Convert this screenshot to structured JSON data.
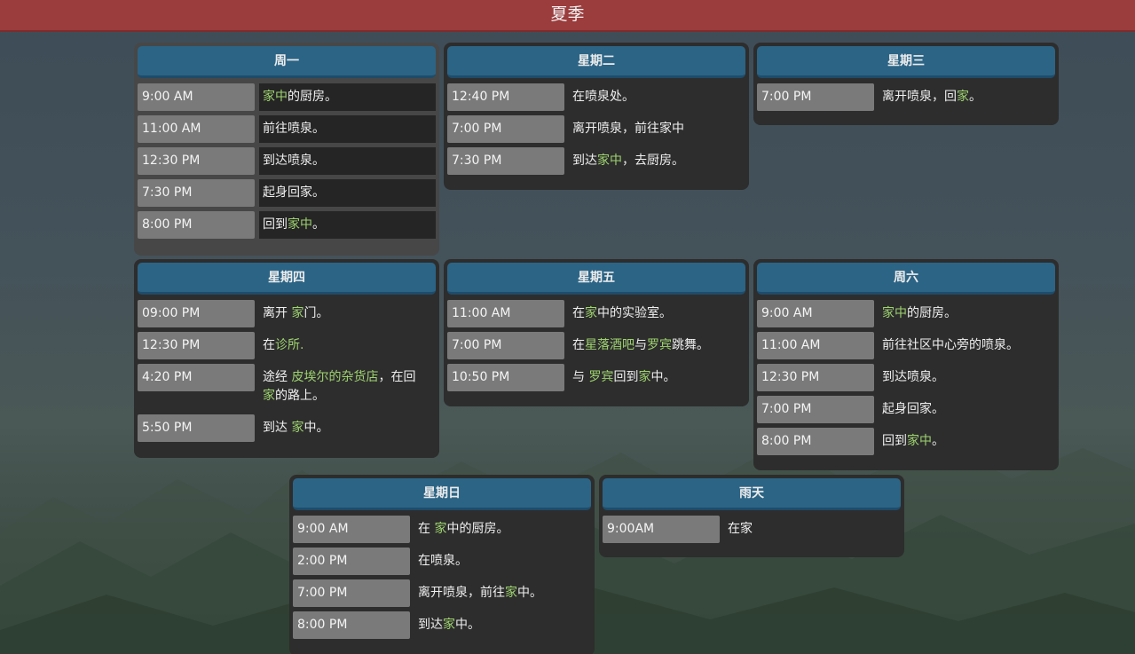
{
  "page": {
    "title": "夏季"
  },
  "colors": {
    "topbar": "#9b3c3d",
    "header": "#2c6485",
    "card": "#2d2d2d",
    "time_cell": "#7a7a7a",
    "highlight": "#9ed36f"
  },
  "cards": [
    {
      "title": "周一",
      "rows": [
        {
          "time": "9:00 AM",
          "desc": [
            {
              "t": "家中",
              "hl": true
            },
            {
              "t": "的厨房。"
            }
          ]
        },
        {
          "time": "11:00 AM",
          "desc": [
            {
              "t": "前往喷泉。"
            }
          ]
        },
        {
          "time": "12:30 PM",
          "desc": [
            {
              "t": "到达喷泉。"
            }
          ]
        },
        {
          "time": "7:30 PM",
          "desc": [
            {
              "t": "起身回家。"
            }
          ]
        },
        {
          "time": "8:00 PM",
          "desc": [
            {
              "t": "回到"
            },
            {
              "t": "家中",
              "hl": true
            },
            {
              "t": "。"
            }
          ]
        }
      ]
    },
    {
      "title": "星期二",
      "rows": [
        {
          "time": "12:40 PM",
          "desc": [
            {
              "t": "在喷泉处。"
            }
          ]
        },
        {
          "time": "7:00 PM",
          "desc": [
            {
              "t": "离开喷泉，前往家中"
            }
          ]
        },
        {
          "time": "7:30 PM",
          "desc": [
            {
              "t": "到达"
            },
            {
              "t": "家中",
              "hl": true
            },
            {
              "t": "，去厨房。"
            }
          ]
        }
      ]
    },
    {
      "title": "星期三",
      "rows": [
        {
          "time": "7:00 PM",
          "desc": [
            {
              "t": "离开喷泉，回"
            },
            {
              "t": "家",
              "hl": true
            },
            {
              "t": "。"
            }
          ]
        }
      ]
    },
    {
      "title": "星期四",
      "rows": [
        {
          "time": "09:00 PM",
          "desc": [
            {
              "t": "离开 "
            },
            {
              "t": "家",
              "hl": true
            },
            {
              "t": "门。"
            }
          ]
        },
        {
          "time": "12:30 PM",
          "desc": [
            {
              "t": "在"
            },
            {
              "t": "诊所.",
              "hl": true
            }
          ]
        },
        {
          "time": "4:20 PM",
          "desc": [
            {
              "t": "途经 "
            },
            {
              "t": "皮埃尔的杂货店",
              "hl": true
            },
            {
              "t": "，在回 "
            },
            {
              "t": "家",
              "hl": true
            },
            {
              "t": "的路上。"
            }
          ]
        },
        {
          "time": "5:50 PM",
          "desc": [
            {
              "t": "到达 "
            },
            {
              "t": "家",
              "hl": true
            },
            {
              "t": "中。"
            }
          ]
        }
      ]
    },
    {
      "title": "星期五",
      "rows": [
        {
          "time": "11:00 AM",
          "desc": [
            {
              "t": "在"
            },
            {
              "t": "家",
              "hl": true
            },
            {
              "t": "中的实验室。"
            }
          ]
        },
        {
          "time": "7:00 PM",
          "desc": [
            {
              "t": "在"
            },
            {
              "t": "星落酒吧",
              "hl": true
            },
            {
              "t": "与"
            },
            {
              "t": "罗宾",
              "hl": true
            },
            {
              "t": "跳舞。"
            }
          ]
        },
        {
          "time": "10:50 PM",
          "desc": [
            {
              "t": "与 "
            },
            {
              "t": "罗宾",
              "hl": true
            },
            {
              "t": "回到"
            },
            {
              "t": "家",
              "hl": true
            },
            {
              "t": "中。"
            }
          ]
        }
      ]
    },
    {
      "title": "周六",
      "rows": [
        {
          "time": "9:00 AM",
          "desc": [
            {
              "t": "家中",
              "hl": true
            },
            {
              "t": "的厨房。"
            }
          ]
        },
        {
          "time": "11:00 AM",
          "desc": [
            {
              "t": "前往社区中心旁的喷泉。"
            }
          ]
        },
        {
          "time": "12:30 PM",
          "desc": [
            {
              "t": "到达喷泉。"
            }
          ]
        },
        {
          "time": "7:00 PM",
          "desc": [
            {
              "t": "起身回家。"
            }
          ]
        },
        {
          "time": "8:00 PM",
          "desc": [
            {
              "t": "回到"
            },
            {
              "t": "家中",
              "hl": true
            },
            {
              "t": "。"
            }
          ]
        }
      ]
    },
    {
      "title": "星期日",
      "rows": [
        {
          "time": "9:00 AM",
          "desc": [
            {
              "t": "在 "
            },
            {
              "t": "家",
              "hl": true
            },
            {
              "t": "中的厨房。"
            }
          ]
        },
        {
          "time": "2:00 PM",
          "desc": [
            {
              "t": "在喷泉。"
            }
          ]
        },
        {
          "time": "7:00 PM",
          "desc": [
            {
              "t": "离开喷泉，前往"
            },
            {
              "t": "家",
              "hl": true
            },
            {
              "t": "中。"
            }
          ]
        },
        {
          "time": "8:00 PM",
          "desc": [
            {
              "t": "到达"
            },
            {
              "t": "家",
              "hl": true
            },
            {
              "t": "中。"
            }
          ]
        }
      ]
    },
    {
      "title": "雨天",
      "rows": [
        {
          "time": "9:00AM",
          "desc": [
            {
              "t": "在家"
            }
          ]
        }
      ]
    }
  ]
}
